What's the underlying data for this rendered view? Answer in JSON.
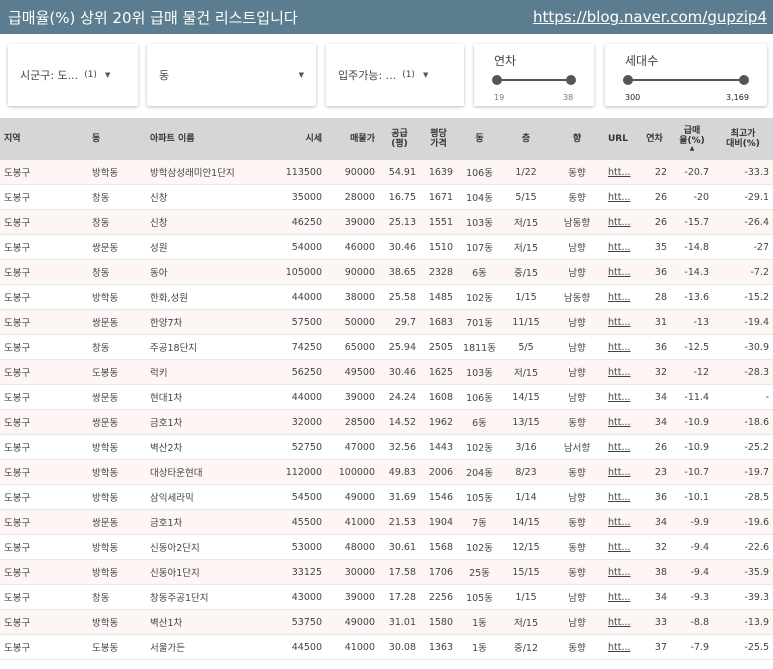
{
  "header": {
    "title": "급매율(%) 상위 20위 급매 물건 리스트입니다",
    "link": "https://blog.naver.com/gupzip4"
  },
  "filters": {
    "sigungu": {
      "label": "시군구: 도...",
      "count": "(1)"
    },
    "dong": {
      "label": "동"
    },
    "move_in": {
      "label": "입주가능: ...",
      "count": "(1)"
    },
    "year": {
      "title": "연차",
      "min": "19",
      "max": "38"
    },
    "households": {
      "title": "세대수",
      "min": "300",
      "max": "3,169"
    }
  },
  "columns": {
    "region": "지역",
    "dong": "동",
    "apt": "아파트 이름",
    "price": "시세",
    "sale": "매물가",
    "area_top": "공급",
    "area_bottom": "(평)",
    "ppp_top": "평당",
    "ppp_bottom": "가격",
    "building": "동",
    "floor": "층",
    "dir": "향",
    "url": "URL",
    "year": "연차",
    "rate_top": "급매",
    "rate_bottom": "율(%)",
    "rate_sort": "▲",
    "peak_top": "최고가",
    "peak_bottom": "대비(%)"
  },
  "rows": [
    [
      "도봉구",
      "방학동",
      "방학삼성래미안1단지",
      "113500",
      "90000",
      "54.91",
      "1639",
      "106동",
      "1/22",
      "동향",
      "htt...",
      "22",
      "-20.7",
      "-33.3"
    ],
    [
      "도봉구",
      "창동",
      "신창",
      "35000",
      "28000",
      "16.75",
      "1671",
      "104동",
      "5/15",
      "동향",
      "htt...",
      "26",
      "-20",
      "-29.1"
    ],
    [
      "도봉구",
      "창동",
      "신창",
      "46250",
      "39000",
      "25.13",
      "1551",
      "103동",
      "저/15",
      "남동향",
      "htt...",
      "26",
      "-15.7",
      "-26.4"
    ],
    [
      "도봉구",
      "쌍문동",
      "성원",
      "54000",
      "46000",
      "30.46",
      "1510",
      "107동",
      "저/15",
      "남향",
      "htt...",
      "35",
      "-14.8",
      "-27"
    ],
    [
      "도봉구",
      "창동",
      "동아",
      "105000",
      "90000",
      "38.65",
      "2328",
      "6동",
      "중/15",
      "남향",
      "htt...",
      "36",
      "-14.3",
      "-7.2"
    ],
    [
      "도봉구",
      "방학동",
      "한화,성원",
      "44000",
      "38000",
      "25.58",
      "1485",
      "102동",
      "1/15",
      "남동향",
      "htt...",
      "28",
      "-13.6",
      "-15.2"
    ],
    [
      "도봉구",
      "쌍문동",
      "한양7차",
      "57500",
      "50000",
      "29.7",
      "1683",
      "701동",
      "11/15",
      "남향",
      "htt...",
      "31",
      "-13",
      "-19.4"
    ],
    [
      "도봉구",
      "창동",
      "주공18단지",
      "74250",
      "65000",
      "25.94",
      "2505",
      "1811동",
      "5/5",
      "남향",
      "htt...",
      "36",
      "-12.5",
      "-30.9"
    ],
    [
      "도봉구",
      "도봉동",
      "럭키",
      "56250",
      "49500",
      "30.46",
      "1625",
      "103동",
      "저/15",
      "남향",
      "htt...",
      "32",
      "-12",
      "-28.3"
    ],
    [
      "도봉구",
      "쌍문동",
      "현대1차",
      "44000",
      "39000",
      "24.24",
      "1608",
      "106동",
      "14/15",
      "남향",
      "htt...",
      "34",
      "-11.4",
      "-"
    ],
    [
      "도봉구",
      "쌍문동",
      "금호1차",
      "32000",
      "28500",
      "14.52",
      "1962",
      "6동",
      "13/15",
      "동향",
      "htt...",
      "34",
      "-10.9",
      "-18.6"
    ],
    [
      "도봉구",
      "방학동",
      "벽산2차",
      "52750",
      "47000",
      "32.56",
      "1443",
      "102동",
      "3/16",
      "남서향",
      "htt...",
      "26",
      "-10.9",
      "-25.2"
    ],
    [
      "도봉구",
      "방학동",
      "대상타운현대",
      "112000",
      "100000",
      "49.83",
      "2006",
      "204동",
      "8/23",
      "동향",
      "htt...",
      "23",
      "-10.7",
      "-19.7"
    ],
    [
      "도봉구",
      "방학동",
      "삼익세라믹",
      "54500",
      "49000",
      "31.69",
      "1546",
      "105동",
      "1/14",
      "남향",
      "htt...",
      "36",
      "-10.1",
      "-28.5"
    ],
    [
      "도봉구",
      "쌍문동",
      "금호1차",
      "45500",
      "41000",
      "21.53",
      "1904",
      "7동",
      "14/15",
      "동향",
      "htt...",
      "34",
      "-9.9",
      "-19.6"
    ],
    [
      "도봉구",
      "방학동",
      "신동아2단지",
      "53000",
      "48000",
      "30.61",
      "1568",
      "102동",
      "12/15",
      "동향",
      "htt...",
      "32",
      "-9.4",
      "-22.6"
    ],
    [
      "도봉구",
      "방학동",
      "신동아1단지",
      "33125",
      "30000",
      "17.58",
      "1706",
      "25동",
      "15/15",
      "동향",
      "htt...",
      "38",
      "-9.4",
      "-35.9"
    ],
    [
      "도봉구",
      "창동",
      "창동주공1단지",
      "43000",
      "39000",
      "17.28",
      "2256",
      "105동",
      "1/15",
      "남향",
      "htt...",
      "34",
      "-9.3",
      "-39.3"
    ],
    [
      "도봉구",
      "방학동",
      "벽산1차",
      "53750",
      "49000",
      "31.01",
      "1580",
      "1동",
      "저/15",
      "남향",
      "htt...",
      "33",
      "-8.8",
      "-13.9"
    ],
    [
      "도봉구",
      "도봉동",
      "서울가든",
      "44500",
      "41000",
      "30.08",
      "1363",
      "1동",
      "중/12",
      "동향",
      "htt...",
      "37",
      "-7.9",
      "-25.5"
    ]
  ]
}
